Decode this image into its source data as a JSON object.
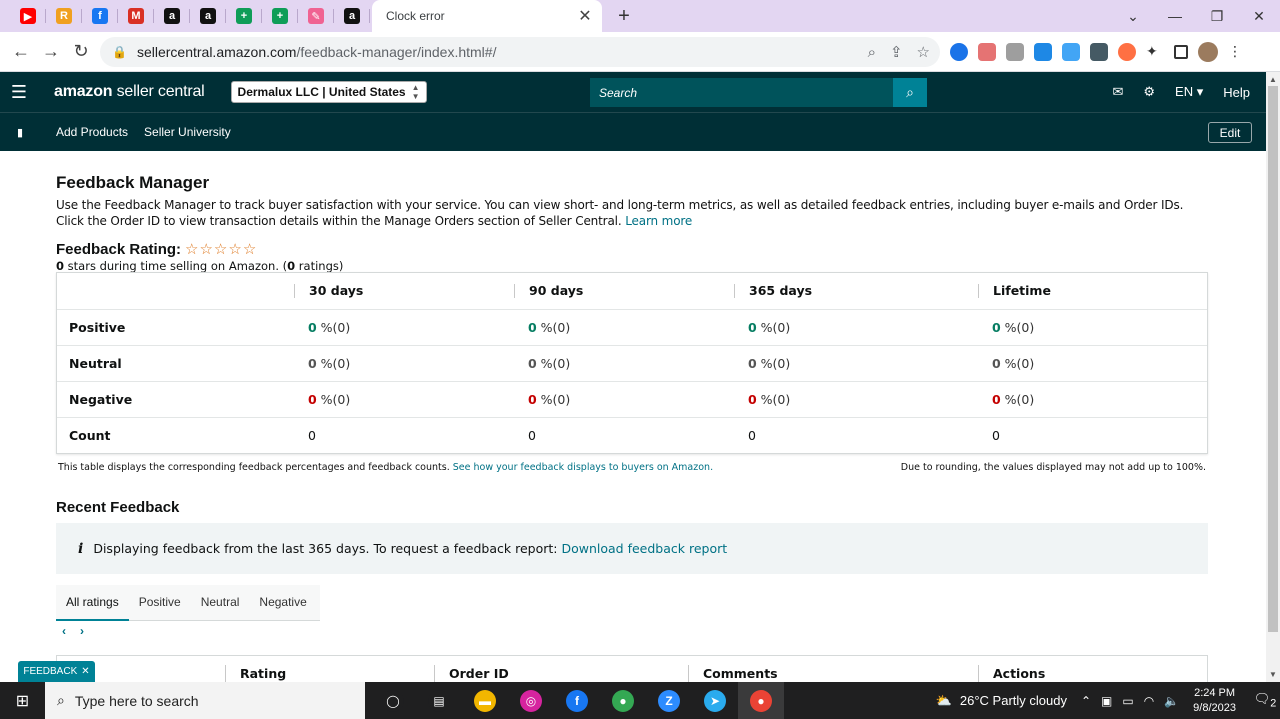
{
  "browser": {
    "active_tab_title": "Clock error",
    "url_host": "sellercentral.amazon.com",
    "url_path": "/feedback-manager/index.html#/",
    "favicons": [
      {
        "name": "youtube-icon",
        "glyph": "▶",
        "color": "#ff0000"
      },
      {
        "name": "r-app-icon",
        "glyph": "R",
        "color": "#f0a020"
      },
      {
        "name": "facebook-icon",
        "glyph": "f",
        "color": "#1877f2"
      },
      {
        "name": "gmail-icon",
        "glyph": "M",
        "color": "#d93025"
      },
      {
        "name": "amazon-icon",
        "glyph": "a",
        "color": "#111111"
      },
      {
        "name": "amazon-icon",
        "glyph": "a",
        "color": "#111111"
      },
      {
        "name": "sheets-icon",
        "glyph": "+",
        "color": "#0f9d58"
      },
      {
        "name": "sheets-icon",
        "glyph": "+",
        "color": "#0f9d58"
      },
      {
        "name": "pen-icon",
        "glyph": "✎",
        "color": "#f06292"
      },
      {
        "name": "amazon-icon",
        "glyph": "a",
        "color": "#111111"
      }
    ]
  },
  "header": {
    "logo_bold": "amazon",
    "logo_rest": " seller central",
    "account": "Dermalux LLC | United States",
    "search_placeholder": "Search",
    "lang": "EN",
    "help": "Help"
  },
  "subnav": {
    "items": [
      "Add Products",
      "Seller University"
    ],
    "edit": "Edit"
  },
  "main": {
    "title": "Feedback Manager",
    "intro": "Use the Feedback Manager to track buyer satisfaction with your service. You can view short- and long-term metrics, as well as detailed feedback entries, including buyer e-mails and Order IDs. Click the Order ID to view transaction details within the Manage Orders section of Seller Central.",
    "learn_more": "Learn more",
    "rating_label": "Feedback Rating:",
    "stars": "☆☆☆☆☆",
    "rating_sub_bold": "0",
    "rating_sub_text": " stars during time selling on Amazon. (",
    "rating_sub_count": "0",
    "rating_sub_end": " ratings)",
    "table": {
      "columns": [
        "30 days",
        "90 days",
        "365 days",
        "Lifetime"
      ],
      "rows": [
        {
          "label": "Positive",
          "cells": [
            {
              "n": "0",
              "p": " %(0)"
            },
            {
              "n": "0",
              "p": " %(0)"
            },
            {
              "n": "0",
              "p": " %(0)"
            },
            {
              "n": "0",
              "p": " %(0)"
            }
          ]
        },
        {
          "label": "Neutral",
          "cells": [
            {
              "n": "0",
              "p": " %(0)"
            },
            {
              "n": "0",
              "p": " %(0)"
            },
            {
              "n": "0",
              "p": " %(0)"
            },
            {
              "n": "0",
              "p": " %(0)"
            }
          ]
        },
        {
          "label": "Negative",
          "cells": [
            {
              "n": "0",
              "p": " %(0)"
            },
            {
              "n": "0",
              "p": " %(0)"
            },
            {
              "n": "0",
              "p": " %(0)"
            },
            {
              "n": "0",
              "p": " %(0)"
            }
          ]
        },
        {
          "label": "Count",
          "cells": [
            "0",
            "0",
            "0",
            "0"
          ]
        }
      ]
    },
    "footnote_left": "This table displays the corresponding feedback percentages and feedback counts.",
    "footnote_link": "See how your feedback displays to buyers on Amazon.",
    "footnote_right": "Due to rounding, the values displayed may not add up to 100%.",
    "recent_title": "Recent Feedback",
    "info_text": "Displaying feedback from the last 365 days. To request a feedback report:",
    "info_link": "Download feedback report",
    "tabs": [
      "All ratings",
      "Positive",
      "Neutral",
      "Negative"
    ],
    "results_columns": [
      "Rating",
      "Order ID",
      "Comments",
      "Actions"
    ],
    "feedback_pill": "FEEDBACK"
  },
  "taskbar": {
    "search_placeholder": "Type here to search",
    "weather": "26°C  Partly cloudy",
    "time": "2:24 PM",
    "date": "9/8/2023",
    "notif_count": "2",
    "apps": [
      {
        "name": "task-view-icon",
        "glyph": "◯",
        "color": "#1f1f20"
      },
      {
        "name": "widgets-icon",
        "glyph": "▤",
        "color": "#1f1f20"
      },
      {
        "name": "file-explorer-icon",
        "glyph": "▬",
        "color": "#f2b600"
      },
      {
        "name": "instagram-icon",
        "glyph": "◎",
        "color": "#d6249f"
      },
      {
        "name": "facebook-app-icon",
        "glyph": "f",
        "color": "#1877f2"
      },
      {
        "name": "chrome-icon",
        "glyph": "●",
        "color": "#34a853"
      },
      {
        "name": "zoom-icon",
        "glyph": "Z",
        "color": "#2d8cff"
      },
      {
        "name": "telegram-icon",
        "glyph": "➤",
        "color": "#2aabee"
      },
      {
        "name": "chrome-profile-icon",
        "glyph": "●",
        "color": "#ea4335"
      }
    ]
  }
}
